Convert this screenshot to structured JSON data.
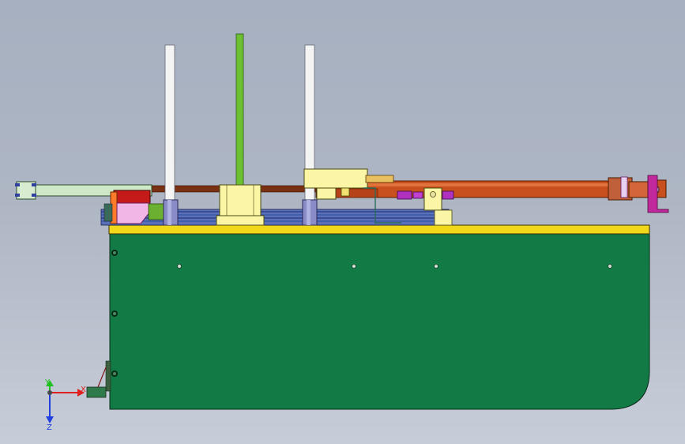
{
  "scene": {
    "background_top": "#a6b0c0",
    "background_bottom": "#c7cdd8",
    "colors": {
      "base_plate": "#127a45",
      "top_rail": "#f2d81a",
      "cylinder_rod": "#c8501e",
      "pale_yellow_part": "#fbf5a6",
      "green_rod": "#6cc032",
      "white_post": "#f4f4f4",
      "arm_green": "#cfe8c8",
      "pink_block": "#f2b6e6",
      "red_block": "#c41a1a",
      "orange_plate": "#ff7a2a",
      "slate_blue": "#8a8cc8",
      "navy_rails": "#2a4aa0",
      "magenta_parts": "#c0289c"
    }
  },
  "triad": {
    "x_label": "X",
    "y_label": "Y",
    "z_label": "Z",
    "x_color": "#e02020",
    "y_color": "#20c020",
    "z_color": "#2040e0"
  }
}
